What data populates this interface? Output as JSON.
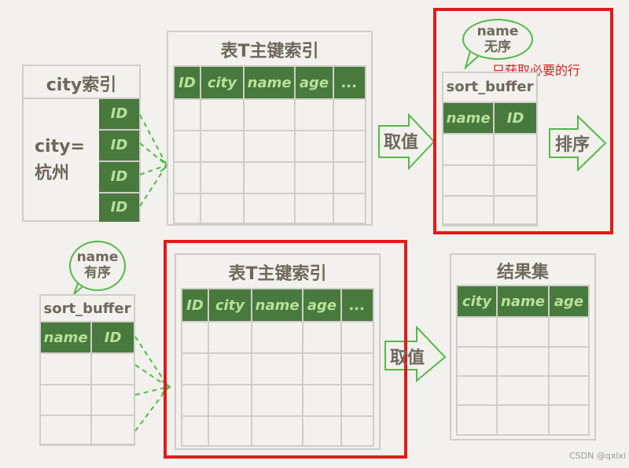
{
  "city_index": {
    "title": "city索引",
    "condition_line1": "city=",
    "condition_line2": "杭州",
    "id_cells": [
      "ID",
      "ID",
      "ID",
      "ID"
    ]
  },
  "primary_index_top": {
    "title": "表T主键索引",
    "columns": [
      "ID",
      "city",
      "name",
      "age",
      "..."
    ],
    "row_count": 4
  },
  "arrow_fetch_top": {
    "label": "取值"
  },
  "sort_buffer_top": {
    "bubble_line1": "name",
    "bubble_line2": "无序",
    "title": "sort_buffer",
    "columns": [
      "name",
      "ID"
    ],
    "row_count": 3
  },
  "annotation": {
    "text": "只获取必要的行"
  },
  "arrow_sort": {
    "label": "排序"
  },
  "sort_buffer_bottom": {
    "bubble_line1": "name",
    "bubble_line2": "有序",
    "title": "sort_buffer",
    "columns": [
      "name",
      "ID"
    ],
    "row_count": 3
  },
  "primary_index_bottom": {
    "title": "表T主键索引",
    "columns": [
      "ID",
      "city",
      "name",
      "age",
      "..."
    ],
    "row_count": 4
  },
  "arrow_fetch_bottom": {
    "label": "取值"
  },
  "result_set": {
    "title": "结果集",
    "columns": [
      "city",
      "name",
      "age"
    ],
    "row_count": 4
  },
  "watermark": {
    "text": "CSDN @qxlxi"
  },
  "colors": {
    "header_green": "#487a3e",
    "header_text": "#b9e09a",
    "arrow_green": "#56b84a",
    "highlight_red": "#e01b1b",
    "grid": "#cfcdc8"
  }
}
